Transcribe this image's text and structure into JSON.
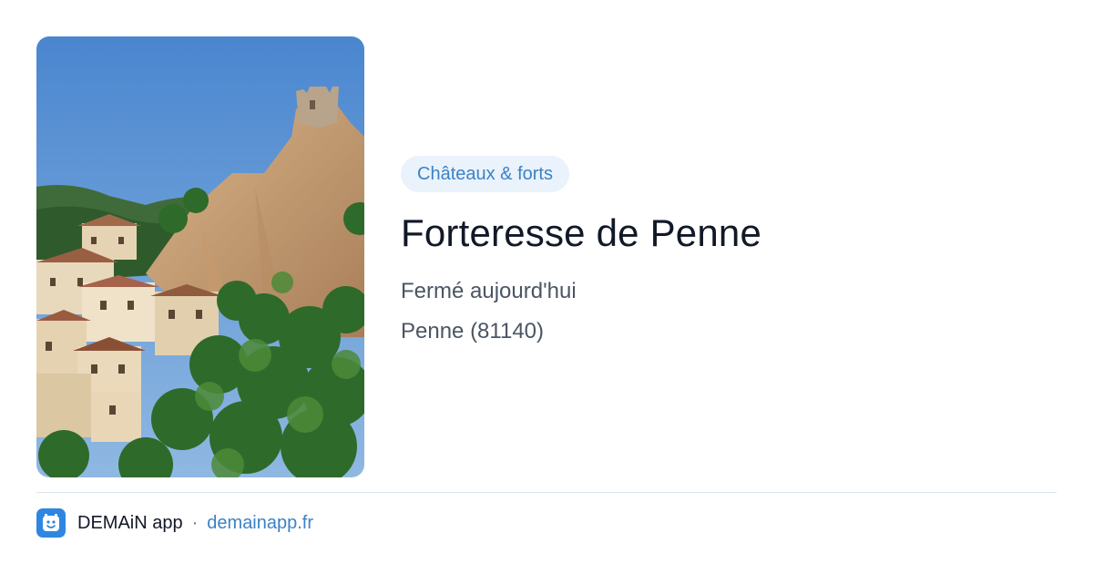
{
  "place": {
    "category": "Châteaux & forts",
    "title": "Forteresse de Penne",
    "status": "Fermé aujourd'hui",
    "location": "Penne (81140)"
  },
  "photo": {
    "description_icon": "castle-photo"
  },
  "footer": {
    "app_name": "DEMAiN app",
    "separator": "·",
    "domain": "demainapp.fr"
  },
  "colors": {
    "accent": "#3b82c8",
    "badge_bg": "#eaf2fc",
    "logo_bg": "#2f86e0"
  }
}
